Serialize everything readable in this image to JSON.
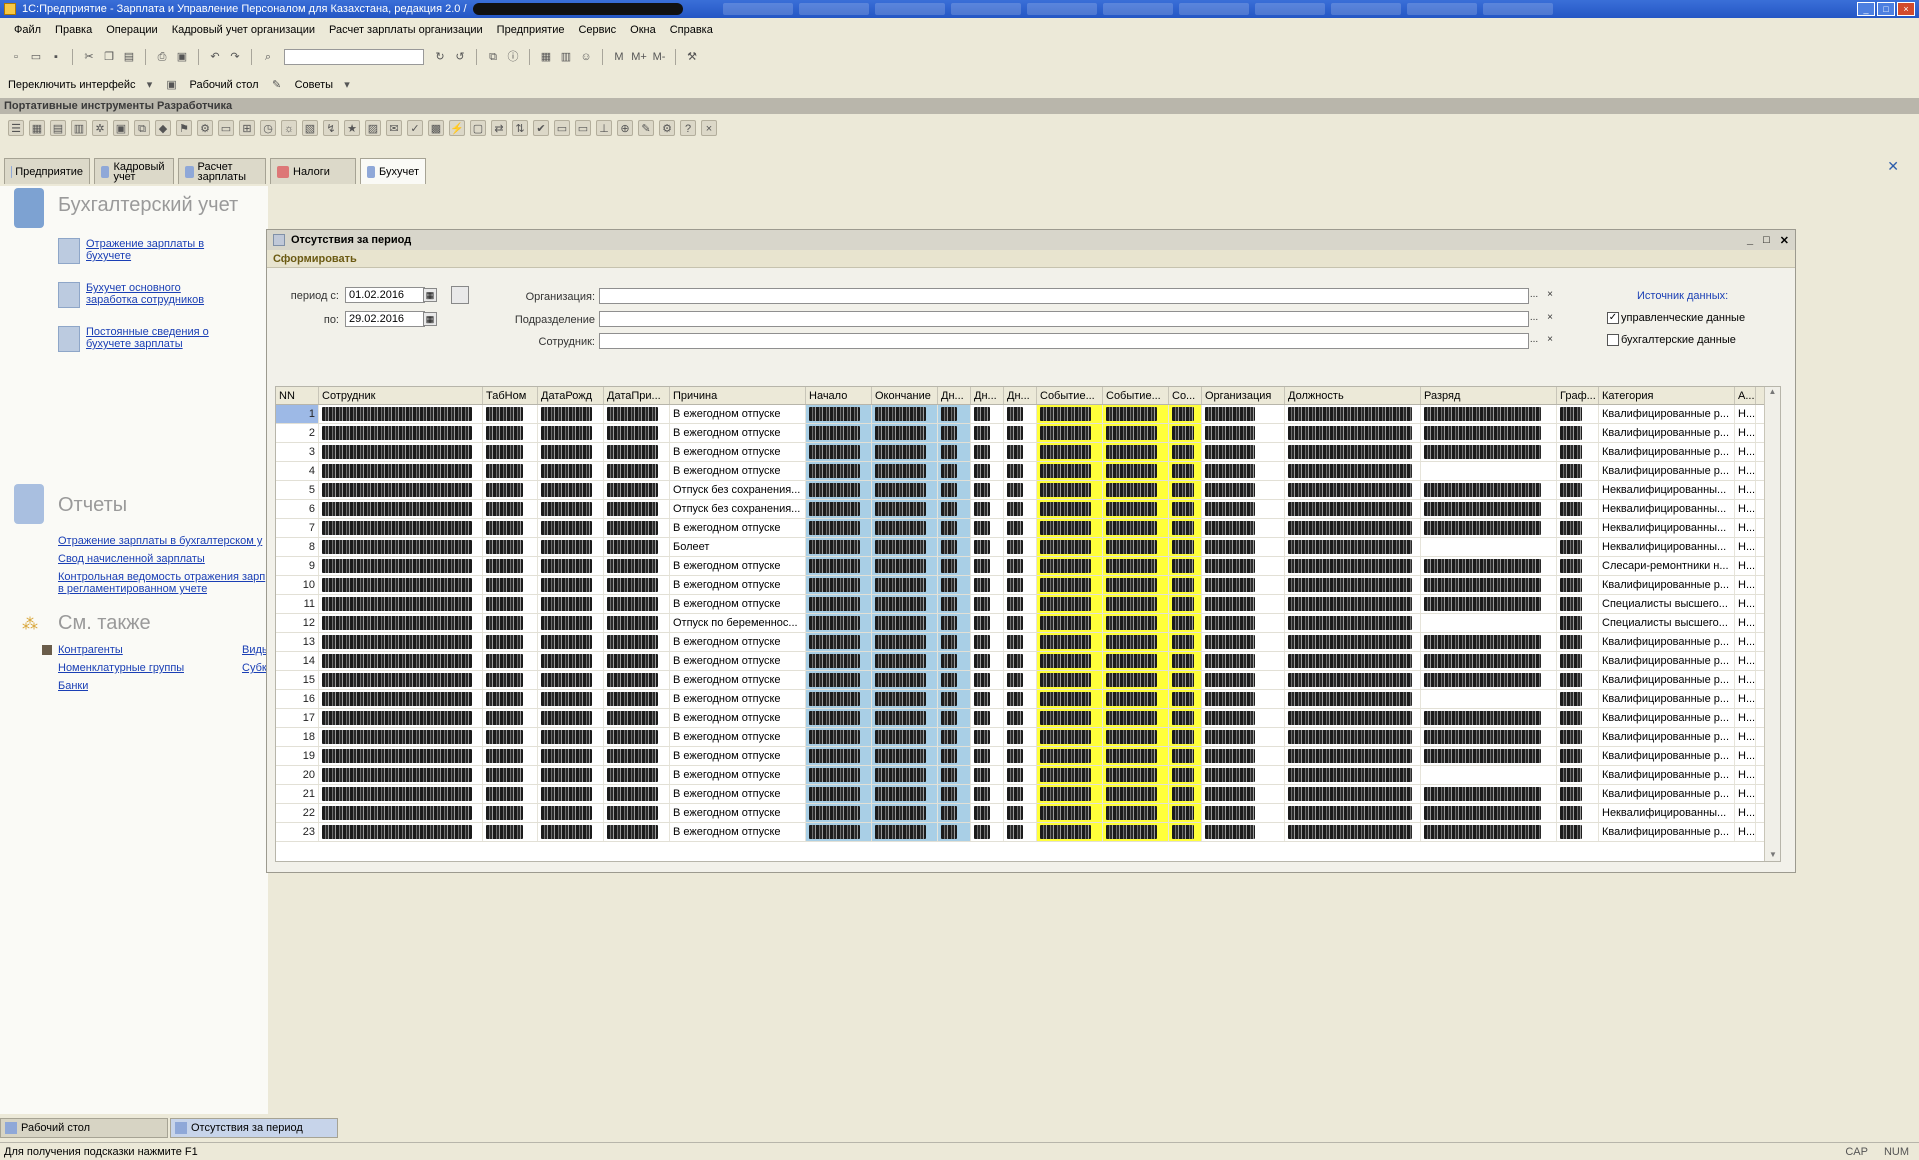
{
  "window": {
    "title": "1С:Предприятие - Зарплата и Управление Персоналом для Казахстана, редакция 2.0 /"
  },
  "menu": [
    "Файл",
    "Правка",
    "Операции",
    "Кадровый учет организации",
    "Расчет зарплаты организации",
    "Предприятие",
    "Сервис",
    "Окна",
    "Справка"
  ],
  "toolbar2": {
    "switch_interface": "Переключить интерфейс",
    "desktop": "Рабочий стол",
    "tips": "Советы"
  },
  "toolbar1": {
    "memory": [
      "M",
      "M+",
      "M-"
    ]
  },
  "devbar_caption": "Портативные инструменты Разработчика",
  "section_tabs": [
    {
      "label": "Предприятие"
    },
    {
      "label": "Кадровый учет"
    },
    {
      "label": "Расчет зарплаты"
    },
    {
      "label": "Налоги"
    },
    {
      "label": "Бухучет"
    }
  ],
  "left_panel": {
    "heading": "Бухгалтерский учет",
    "links": [
      "Отражение зарплаты в бухучете",
      "Бухучет основного заработка сотрудников",
      "Постоянные сведения о бухучете зарплаты"
    ],
    "reports_heading": "Отчеты",
    "reports": [
      "Отражение зарплаты в бухгалтерском у",
      "Свод начисленной зарплаты",
      "Контрольная ведомость отражения зарп",
      "в регламентированном учете"
    ],
    "see_also_heading": "См. также",
    "see_also": [
      "Контрагенты",
      "Номенклатурные группы",
      "Банки"
    ],
    "see_also_right": [
      "Виды",
      "Субк"
    ]
  },
  "doc": {
    "title": "Отсутствия за период",
    "command": "Сформировать",
    "period_from_label": "период с:",
    "period_from": "01.02.2016",
    "period_to_label": "по:",
    "period_to": "29.02.2016",
    "org_label": "Организация:",
    "dept_label": "Подразделение",
    "emp_label": "Сотрудник:",
    "pick": "...",
    "clear": "×",
    "source_title": "Источник данных:",
    "mgmt_data": "управленческие данные",
    "mgmt_checked": true,
    "acct_data": "бухгалтерские данные",
    "acct_checked": false
  },
  "table": {
    "columns": [
      "NN",
      "Сотрудник",
      "ТабНом",
      "ДатаРожд",
      "ДатаПри...",
      "Причина",
      "Начало",
      "Окончание",
      "Дн...",
      "Дн...",
      "Дн...",
      "Событие...",
      "Событие...",
      "Со...",
      "Организация",
      "Должность",
      "Разряд",
      "Граф...",
      "Категория",
      "А..."
    ],
    "rows": [
      {
        "nn": "1",
        "reason": "В ежегодном отпуске",
        "category": "Квалифицированные р...",
        "a": "Н..."
      },
      {
        "nn": "2",
        "reason": "В ежегодном отпуске",
        "category": "Квалифицированные р...",
        "a": "Н..."
      },
      {
        "nn": "3",
        "reason": "В ежегодном отпуске",
        "category": "Квалифицированные р...",
        "a": "Н..."
      },
      {
        "nn": "4",
        "reason": "В ежегодном отпуске",
        "category": "Квалифицированные р...",
        "a": "Н..."
      },
      {
        "nn": "5",
        "reason": "Отпуск без сохранения...",
        "category": "Неквалифицированны...",
        "a": "Н..."
      },
      {
        "nn": "6",
        "reason": "Отпуск без сохранения...",
        "category": "Неквалифицированны...",
        "a": "Н..."
      },
      {
        "nn": "7",
        "reason": "В ежегодном отпуске",
        "category": "Неквалифицированны...",
        "a": "Н..."
      },
      {
        "nn": "8",
        "reason": "Болеет",
        "category": "Неквалифицированны...",
        "a": "Н..."
      },
      {
        "nn": "9",
        "reason": "В ежегодном отпуске",
        "category": "Слесари-ремонтники н...",
        "a": "Н..."
      },
      {
        "nn": "10",
        "reason": "В ежегодном отпуске",
        "category": "Квалифицированные р...",
        "a": "Н..."
      },
      {
        "nn": "11",
        "reason": "В ежегодном отпуске",
        "category": "Специалисты высшего...",
        "a": "Н..."
      },
      {
        "nn": "12",
        "reason": "Отпуск по беременнос...",
        "category": "Специалисты высшего...",
        "a": "Н..."
      },
      {
        "nn": "13",
        "reason": "В ежегодном отпуске",
        "category": "Квалифицированные р...",
        "a": "Н..."
      },
      {
        "nn": "14",
        "reason": "В ежегодном отпуске",
        "category": "Квалифицированные р...",
        "a": "Н..."
      },
      {
        "nn": "15",
        "reason": "В ежегодном отпуске",
        "category": "Квалифицированные р...",
        "a": "Н..."
      },
      {
        "nn": "16",
        "reason": "В ежегодном отпуске",
        "category": "Квалифицированные р...",
        "a": "Н..."
      },
      {
        "nn": "17",
        "reason": "В ежегодном отпуске",
        "category": "Квалифицированные р...",
        "a": "Н..."
      },
      {
        "nn": "18",
        "reason": "В ежегодном отпуске",
        "category": "Квалифицированные р...",
        "a": "Н..."
      },
      {
        "nn": "19",
        "reason": "В ежегодном отпуске",
        "category": "Квалифицированные р...",
        "a": "Н..."
      },
      {
        "nn": "20",
        "reason": "В ежегодном отпуске",
        "category": "Квалифицированные р...",
        "a": "Н..."
      },
      {
        "nn": "21",
        "reason": "В ежегодном отпуске",
        "category": "Квалифицированные р...",
        "a": "Н..."
      },
      {
        "nn": "22",
        "reason": "В ежегодном отпуске",
        "category": "Неквалифицированны...",
        "a": "Н..."
      },
      {
        "nn": "23",
        "reason": "В ежегодном отпуске",
        "category": "Квалифицированные р...",
        "a": "Н..."
      }
    ]
  },
  "bottom_tabs": [
    "Рабочий стол",
    "Отсутствия за период"
  ],
  "status": {
    "hint": "Для получения подсказки нажмите F1",
    "cap": "CAP",
    "num": "NUM"
  },
  "colors": {
    "highlight_blue": "#a9cfe6",
    "highlight_yellow": "#ffff3a",
    "link": "#1a3fb5"
  }
}
